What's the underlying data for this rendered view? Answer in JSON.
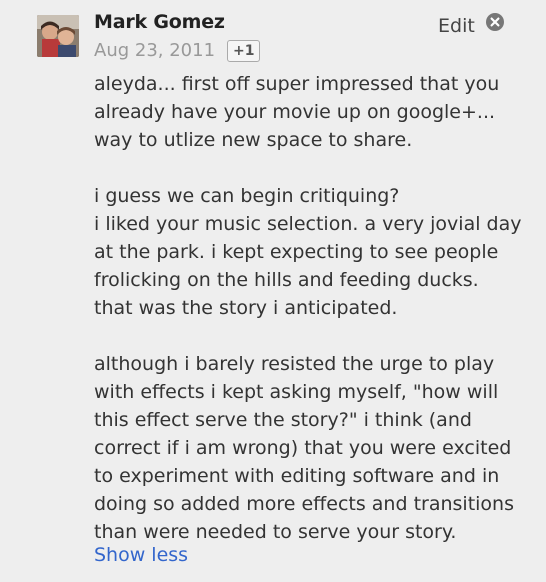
{
  "comment": {
    "author": "Mark Gomez",
    "date": "Aug 23, 2011",
    "plus_one_label": "+1",
    "edit_label": "Edit",
    "paragraphs": [
      [
        "aleyda... first off super impressed that you",
        "already have your movie up on google+...",
        "way to utlize new space to share."
      ],
      [
        "i guess we can begin critiquing?",
        "i liked your music selection. a very jovial day",
        "at the park. i kept expecting to see people",
        "frolicking on the hills and feeding ducks.",
        "that was the story i anticipated."
      ],
      [
        "although i barely resisted the urge to play",
        "with effects i kept asking myself, \"how will",
        "this effect serve the story?\" i think (and",
        "correct if i am wrong) that you were excited",
        "to experiment with editing software and in",
        "doing so added more effects and transitions",
        "than were needed to serve your story."
      ]
    ],
    "show_less_label": "Show less"
  }
}
